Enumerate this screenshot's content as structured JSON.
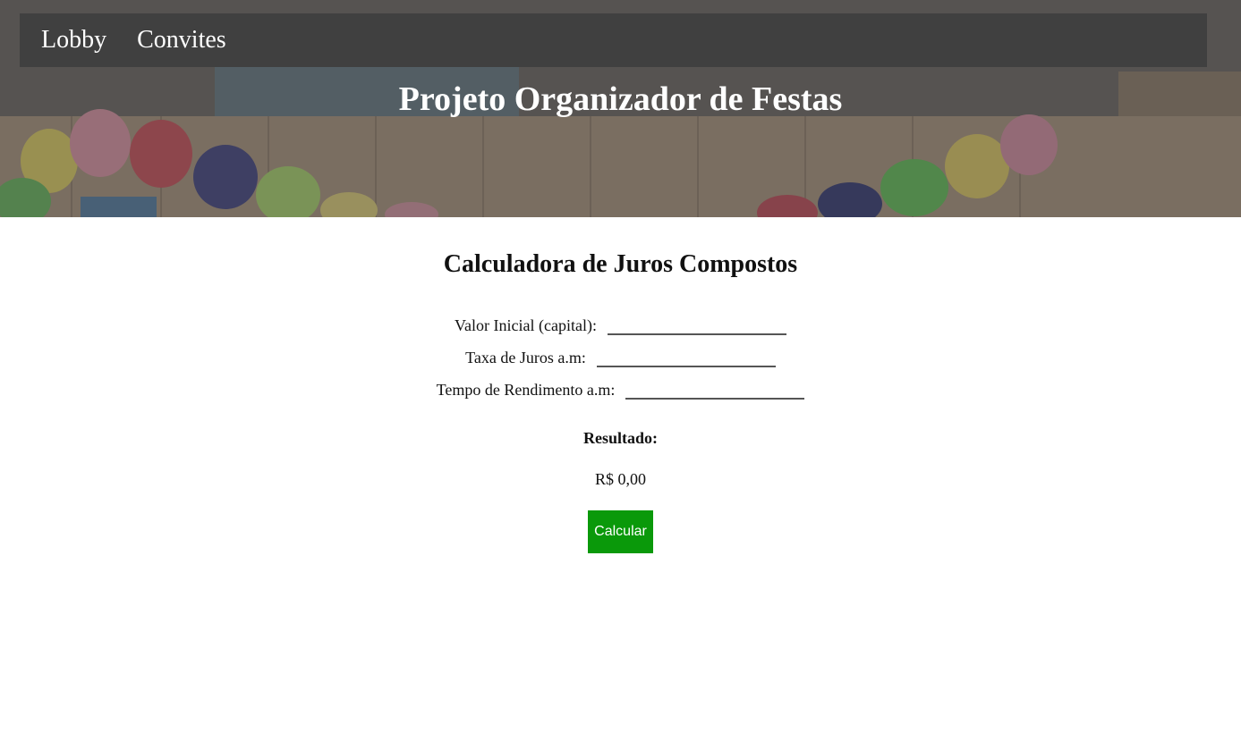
{
  "nav": {
    "items": [
      {
        "label": "Lobby"
      },
      {
        "label": "Convites"
      }
    ]
  },
  "hero": {
    "title": "Projeto Organizador de Festas"
  },
  "calculator": {
    "title": "Calculadora de Juros Compostos",
    "fields": [
      {
        "label": "Valor Inicial (capital):",
        "value": ""
      },
      {
        "label": "Taxa de Juros a.m:",
        "value": ""
      },
      {
        "label": "Tempo de Rendimento a.m:",
        "value": ""
      }
    ],
    "result_label": "Resultado:",
    "result_value": "R$ 0,00",
    "button_label": "Calcular"
  },
  "colors": {
    "nav_background": "#404040",
    "button_background": "#0a990a"
  }
}
